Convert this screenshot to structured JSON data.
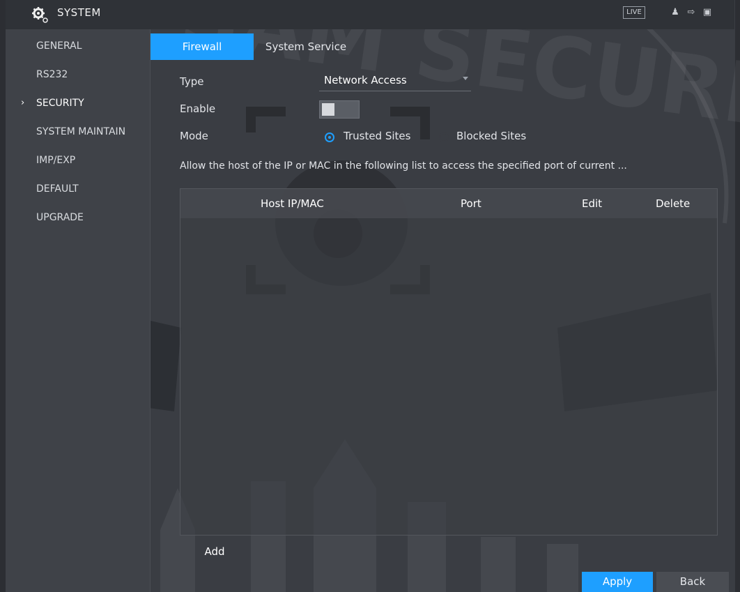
{
  "window": {
    "title": "SYSTEM",
    "live_label": "LIVE"
  },
  "icons": {
    "title": "gear-icon",
    "user": "user-icon",
    "logout": "logout-icon",
    "close": "close-icon"
  },
  "sidebar": {
    "items": [
      {
        "label": "GENERAL"
      },
      {
        "label": "RS232"
      },
      {
        "label": "SECURITY",
        "active": true
      },
      {
        "label": "SYSTEM MAINTAIN"
      },
      {
        "label": "IMP/EXP"
      },
      {
        "label": "DEFAULT"
      },
      {
        "label": "UPGRADE"
      }
    ]
  },
  "tabs": [
    {
      "label": "Firewall",
      "active": true
    },
    {
      "label": "System Service",
      "active": false
    }
  ],
  "form": {
    "type_label": "Type",
    "type_value": "Network Access",
    "enable_label": "Enable",
    "enable_on": false,
    "mode_label": "Mode",
    "mode_options": [
      "Trusted Sites",
      "Blocked Sites"
    ],
    "mode_selected": "Trusted Sites",
    "description": "Allow the host of the IP or MAC in the following list to access the specified port of current ..."
  },
  "table": {
    "columns": [
      "Host IP/MAC",
      "Port",
      "Edit",
      "Delete"
    ],
    "rows": []
  },
  "buttons": {
    "add": "Add",
    "apply": "Apply",
    "back": "Back"
  },
  "watermark": {
    "text": "SAM SECURITY"
  },
  "colors": {
    "accent": "#1e9fff",
    "background": "#3a3d43",
    "sidebar": "#3f4248"
  }
}
